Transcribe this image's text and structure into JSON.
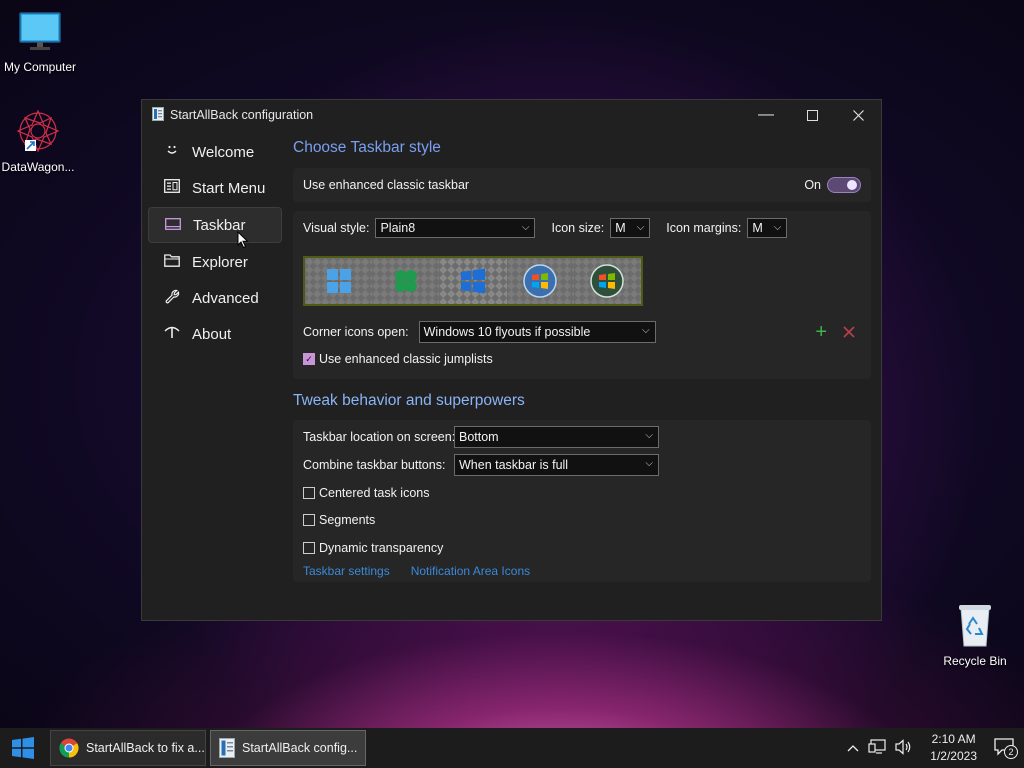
{
  "desktop": {
    "icons": [
      {
        "label": "My Computer",
        "icon": "monitor-icon"
      },
      {
        "label": "DataWagon...",
        "icon": "datawagon-icon"
      },
      {
        "label": "Recycle Bin",
        "icon": "recycle-bin-icon"
      }
    ]
  },
  "window": {
    "title": "StartAllBack configuration",
    "controls": [
      "minimize-icon",
      "maximize-icon",
      "close-icon"
    ]
  },
  "sidebar": {
    "items": [
      {
        "label": "Welcome",
        "icon": "smile-icon"
      },
      {
        "label": "Start Menu",
        "icon": "start-menu-icon"
      },
      {
        "label": "Taskbar",
        "icon": "taskbar-icon",
        "active": true
      },
      {
        "label": "Explorer",
        "icon": "folder-icon"
      },
      {
        "label": "Advanced",
        "icon": "wrench-icon"
      },
      {
        "label": "About",
        "icon": "about-icon"
      }
    ]
  },
  "taskbar_style": {
    "heading": "Choose Taskbar style",
    "enhanced_label": "Use enhanced classic taskbar",
    "toggle_state": "On",
    "visual_style_label": "Visual style:",
    "visual_style_value": "Plain8",
    "icon_size_label": "Icon size:",
    "icon_size_value": "M",
    "icon_margins_label": "Icon margins:",
    "icon_margins_value": "M",
    "style_options": [
      "win11-logo-icon",
      "clover-logo-icon",
      "win10-logo-icon",
      "win7-orb-icon",
      "vista-orb-icon"
    ],
    "corner_icons_label": "Corner icons open:",
    "corner_icons_value": "Windows 10 flyouts if possible",
    "jumplists_label": "Use enhanced classic jumplists"
  },
  "tweaks": {
    "heading": "Tweak behavior and superpowers",
    "location_label": "Taskbar location on screen:",
    "location_value": "Bottom",
    "combine_label": "Combine taskbar buttons:",
    "combine_value": "When taskbar is full",
    "centered_label": "Centered task icons",
    "segments_label": "Segments",
    "dynamic_label": "Dynamic transparency",
    "link_taskbar_settings": "Taskbar settings",
    "link_notification": "Notification Area Icons"
  },
  "taskbar": {
    "apps": [
      {
        "label": "StartAllBack to fix a...",
        "icon": "chrome-icon"
      },
      {
        "label": "StartAllBack config...",
        "icon": "startallback-icon"
      }
    ],
    "time": "2:10 AM",
    "date": "1/2/2023",
    "notification_count": "2"
  },
  "colors": {
    "accent": "#8ab4f8",
    "check": "#c994d6",
    "window_bg": "#202020",
    "panel_bg": "#262626",
    "link": "#3a8ad8"
  }
}
